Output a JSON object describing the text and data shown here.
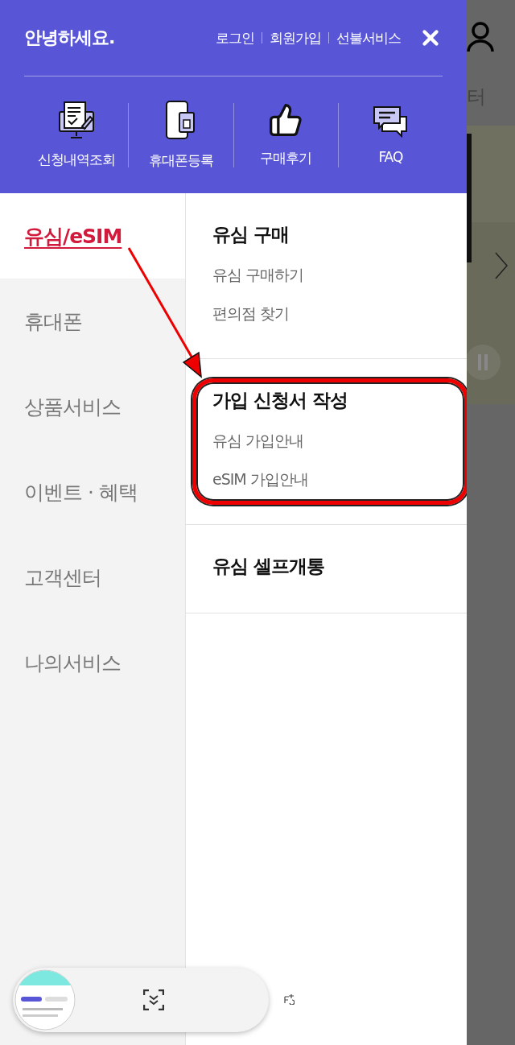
{
  "header": {
    "greeting": "안녕하세요.",
    "links": [
      "로그인",
      "회원가입",
      "선불서비스"
    ]
  },
  "quick_menu": [
    {
      "kind": "history",
      "label": "신청내역조회"
    },
    {
      "kind": "phone",
      "label": "휴대폰등록"
    },
    {
      "kind": "review",
      "label": "구매후기"
    },
    {
      "kind": "faq",
      "label": "FAQ"
    }
  ],
  "categories": [
    {
      "label": "유심/eSIM",
      "selected": true
    },
    {
      "label": "휴대폰",
      "selected": false
    },
    {
      "label": "상품서비스",
      "selected": false
    },
    {
      "label": "이벤트 · 혜택",
      "selected": false
    },
    {
      "label": "고객센터",
      "selected": false
    },
    {
      "label": "나의서비스",
      "selected": false
    }
  ],
  "sections": [
    {
      "title": "유심 구매",
      "highlighted": false,
      "links": [
        "유심 구매하기",
        "편의점 찾기"
      ]
    },
    {
      "title": "가입 신청서 작성",
      "highlighted": true,
      "links": [
        "유심 가입안내",
        "eSIM 가입안내"
      ]
    },
    {
      "title": "유심 셀프개통",
      "highlighted": false
    }
  ],
  "background": {
    "text": "터"
  }
}
